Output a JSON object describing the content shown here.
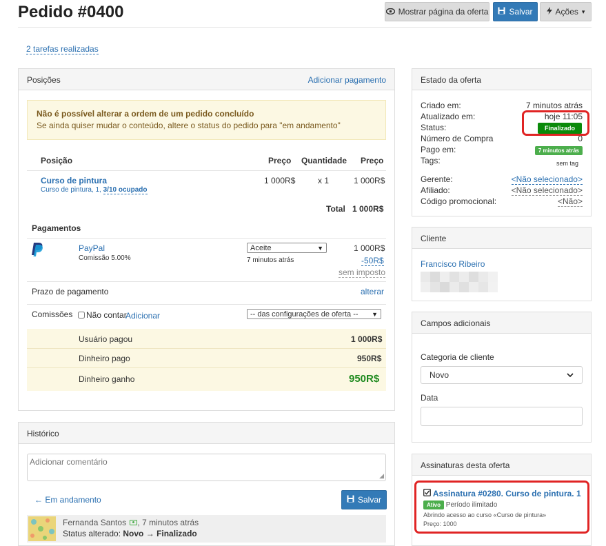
{
  "header": {
    "title": "Pedido #0400",
    "show_offer_label": "Mostrar página da oferta",
    "save_label": "Salvar",
    "actions_label": "Ações"
  },
  "tasks_link": "2 tarefas realizadas",
  "positions": {
    "title": "Posições",
    "add_payment": "Adicionar pagamento",
    "alert_title": "Não é possível alterar a ordem de um pedido concluído",
    "alert_text": "Se ainda quiser mudar o conteúdo, altere o status do pedido para \"em andamento\"",
    "columns": [
      "Posição",
      "Preço",
      "Quantidade",
      "Preço"
    ],
    "item": {
      "name": "Curso de pintura",
      "detail_prefix": "Curso de pintura, 1, ",
      "detail_occupancy": "3/10 ocupado",
      "price": "1 000R$",
      "quantity": "x 1",
      "total_price": "1 000R$"
    },
    "total_label": "Total",
    "total_value": "1 000R$",
    "payments_title": "Pagamentos",
    "payment": {
      "method": "PayPal",
      "commission": "Comissão 5.00%",
      "status": "Aceite",
      "time": "7 minutos atrás",
      "amount": "1 000R$",
      "fee": "-50R$",
      "tax": "sem imposto"
    },
    "deadline_label": "Prazo de pagamento",
    "deadline_action": "alterar",
    "commissions_label": "Comissões",
    "no_count_label": "Não contar",
    "add_label": "Adicionar",
    "commission_select": "-- das configurações de oferta --",
    "summary": [
      {
        "label": "Usuário pagou",
        "value": "1 000R$"
      },
      {
        "label": "Dinheiro pago",
        "value": "950R$"
      },
      {
        "label": "Dinheiro ganho",
        "value": "950R$"
      }
    ]
  },
  "history": {
    "title": "Histórico",
    "comment_placeholder": "Adicionar comentário",
    "status_link": "← Em andamento",
    "save_label": "Salvar",
    "entry_author": "Fernanda Santos",
    "entry_time": ", 7 minutos atrás",
    "entry_prefix": "Status alterado: ",
    "entry_from": "Novo",
    "entry_arrow": " → ",
    "entry_to": "Finalizado"
  },
  "offer_state": {
    "title": "Estado da oferta",
    "rows": [
      {
        "label": "Criado em:",
        "value": "7 minutos atrás"
      },
      {
        "label": "Atualizado em:",
        "value": "hoje 11:05"
      },
      {
        "label": "Status:",
        "value": "Finalizado"
      },
      {
        "label": "Número de Compra",
        "value": "0"
      },
      {
        "label": "Pago em:",
        "value": "7 minutos atrás"
      },
      {
        "label": "Tags:",
        "value": "sem tag"
      },
      {
        "label": "Gerente:",
        "value": "<Não selecionado>"
      },
      {
        "label": "Afiliado:",
        "value": "<Não selecionado>"
      },
      {
        "label": "Código promocional:",
        "value": "<Não>"
      }
    ],
    "status_color": "#0a8a0a",
    "paid_color": "#4cae4c"
  },
  "client": {
    "title": "Cliente",
    "name": "Francisco Ribeiro"
  },
  "extra_fields": {
    "title": "Campos adicionais",
    "category_label": "Categoria de cliente",
    "category_value": "Novo",
    "date_label": "Data",
    "date_value": ""
  },
  "subscriptions": {
    "title": "Assinaturas desta oferta",
    "name": "Assinatura #0280. Curso de pintura. 1",
    "badge": "Ativo",
    "period": "Período ilimitado",
    "access": "Abrindo acesso ao curso «Curso de pintura»",
    "price": "Preço: 1000"
  },
  "colors": {
    "highlight": "#e02424",
    "link": "#2a6fb0",
    "primary": "#337ab7",
    "earned": "#1e8a1e"
  }
}
